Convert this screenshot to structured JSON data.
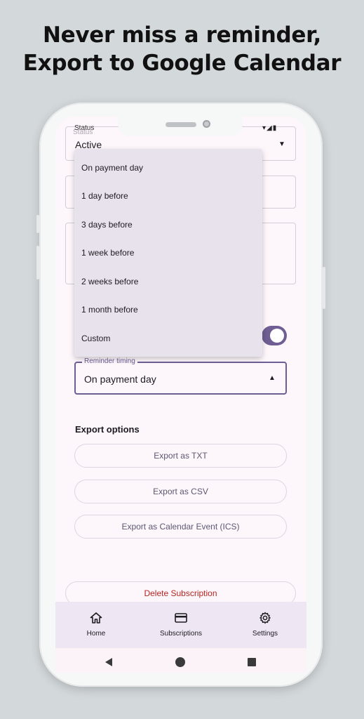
{
  "headline": {
    "line1": "Never miss a reminder,",
    "line2": "Export to Google Calendar"
  },
  "status_bar": {
    "text": "Status",
    "icons": "▾◢▮"
  },
  "status_field": {
    "label": "Status",
    "value": "Active",
    "arrow": "▼"
  },
  "menu": {
    "items": [
      "On payment day",
      "1 day before",
      "3 days before",
      "1 week before",
      "2 weeks before",
      "1 month before",
      "Custom"
    ]
  },
  "reminder_timing": {
    "label": "Reminder timing",
    "value": "On payment day",
    "arrow": "▲"
  },
  "export": {
    "title": "Export options",
    "txt": "Export as TXT",
    "csv": "Export as CSV",
    "ics": "Export as Calendar Event (ICS)"
  },
  "delete_label": "Delete Subscription",
  "nav": {
    "home": {
      "label": "Home",
      "icon": "home-icon"
    },
    "subscriptions": {
      "label": "Subscriptions",
      "icon": "card-icon"
    },
    "settings": {
      "label": "Settings",
      "icon": "gear-icon"
    }
  },
  "colors": {
    "accent": "#6e5e93",
    "danger": "#b3261e",
    "background": "#d3d8da"
  }
}
